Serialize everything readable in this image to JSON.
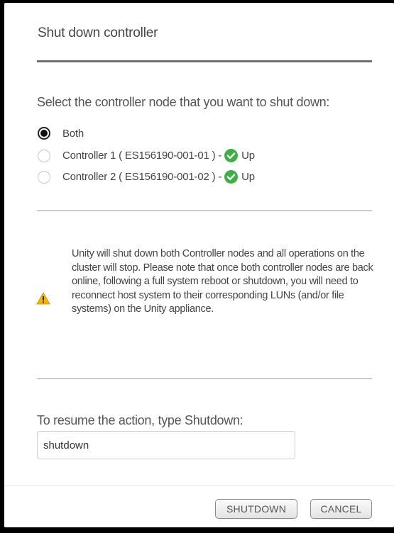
{
  "dialog": {
    "title": "Shut down controller"
  },
  "selection": {
    "prompt": "Select the controller node that you want to shut down:",
    "options": [
      {
        "label": "Both",
        "checked": true
      },
      {
        "label": "Controller 1 ( ES156190-001-01 ) -",
        "status": "Up",
        "checked": false
      },
      {
        "label": "Controller 2 ( ES156190-001-02 ) -",
        "status": "Up",
        "checked": false
      }
    ]
  },
  "warning": {
    "icon": "warning-triangle-icon",
    "text": "Unity will shut down both Controller nodes and all operations on the cluster will stop. Please note that once both controller nodes are back online, following a full system reboot or shutdown, you will need to reconnect host system to their corresponding LUNs (and/or file systems) on the Unity appliance."
  },
  "resume": {
    "label": "To resume the action, type Shutdown:",
    "value": "shutdown"
  },
  "buttons": {
    "shutdown": "SHUTDOWN",
    "cancel": "CANCEL"
  },
  "colors": {
    "status_ok": "#3fae49",
    "warning": "#f2b705"
  }
}
